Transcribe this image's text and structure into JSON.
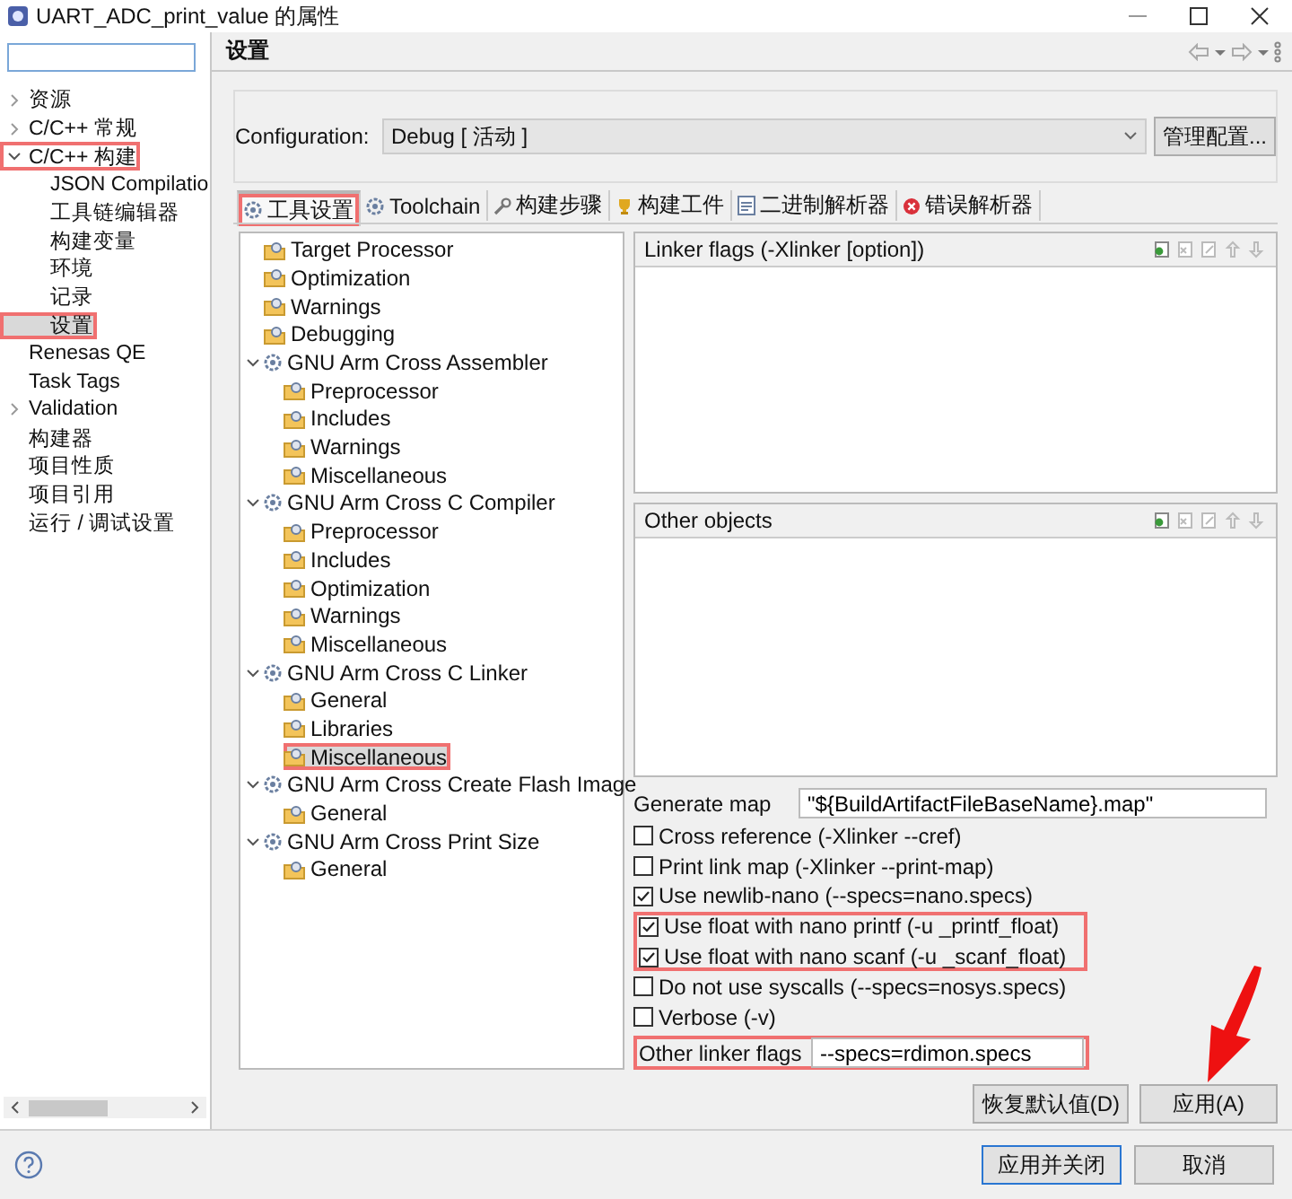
{
  "window": {
    "title": "UART_ADC_print_value 的属性"
  },
  "nav": {
    "items": [
      {
        "label": "资源",
        "expanded": false,
        "selected": false,
        "highlighted": false
      },
      {
        "label": "C/C++ 常规",
        "expanded": false,
        "selected": false,
        "highlighted": false
      },
      {
        "label": "C/C++ 构建",
        "expanded": true,
        "selected": false,
        "highlighted": true,
        "children": [
          {
            "label": "JSON Compilatio",
            "selected": false,
            "highlighted": false
          },
          {
            "label": "工具链编辑器",
            "selected": false,
            "highlighted": false
          },
          {
            "label": "构建变量",
            "selected": false,
            "highlighted": false
          },
          {
            "label": "环境",
            "selected": false,
            "highlighted": false
          },
          {
            "label": "记录",
            "selected": false,
            "highlighted": false
          },
          {
            "label": "设置",
            "selected": true,
            "highlighted": true
          }
        ]
      },
      {
        "label": "Renesas QE",
        "selected": false,
        "highlighted": false
      },
      {
        "label": "Task Tags",
        "selected": false,
        "highlighted": false
      },
      {
        "label": "Validation",
        "expanded": false,
        "selected": false,
        "highlighted": false
      },
      {
        "label": "构建器",
        "selected": false,
        "highlighted": false
      },
      {
        "label": "项目性质",
        "selected": false,
        "highlighted": false
      },
      {
        "label": "项目引用",
        "selected": false,
        "highlighted": false
      },
      {
        "label": "运行 / 调试设置",
        "selected": false,
        "highlighted": false
      }
    ]
  },
  "page": {
    "title": "设置"
  },
  "configuration": {
    "label": "Configuration:",
    "value": "Debug  [ 活动 ]",
    "button": "管理配置..."
  },
  "tabs": [
    {
      "label": "工具设置",
      "selected": true,
      "highlighted": true
    },
    {
      "label": "Toolchain",
      "selected": false,
      "highlighted": false
    },
    {
      "label": "构建步骤",
      "selected": false,
      "highlighted": false
    },
    {
      "label": "构建工件",
      "selected": false,
      "highlighted": false
    },
    {
      "label": "二进制解析器",
      "selected": false,
      "highlighted": false
    },
    {
      "label": "错误解析器",
      "selected": false,
      "highlighted": false
    }
  ],
  "tool_tree": [
    {
      "kind": "option",
      "label": "Target Processor",
      "selected": false,
      "highlighted": false
    },
    {
      "kind": "option",
      "label": "Optimization",
      "selected": false,
      "highlighted": false
    },
    {
      "kind": "option",
      "label": "Warnings",
      "selected": false,
      "highlighted": false
    },
    {
      "kind": "option",
      "label": "Debugging",
      "selected": false,
      "highlighted": false
    },
    {
      "kind": "category",
      "label": "GNU Arm Cross Assembler",
      "expanded": true,
      "selected": false,
      "highlighted": false,
      "children": [
        {
          "kind": "option",
          "label": "Preprocessor",
          "selected": false,
          "highlighted": false
        },
        {
          "kind": "option",
          "label": "Includes",
          "selected": false,
          "highlighted": false
        },
        {
          "kind": "option",
          "label": "Warnings",
          "selected": false,
          "highlighted": false
        },
        {
          "kind": "option",
          "label": "Miscellaneous",
          "selected": false,
          "highlighted": false
        }
      ]
    },
    {
      "kind": "category",
      "label": "GNU Arm Cross C Compiler",
      "expanded": true,
      "selected": false,
      "highlighted": false,
      "children": [
        {
          "kind": "option",
          "label": "Preprocessor",
          "selected": false,
          "highlighted": false
        },
        {
          "kind": "option",
          "label": "Includes",
          "selected": false,
          "highlighted": false
        },
        {
          "kind": "option",
          "label": "Optimization",
          "selected": false,
          "highlighted": false
        },
        {
          "kind": "option",
          "label": "Warnings",
          "selected": false,
          "highlighted": false
        },
        {
          "kind": "option",
          "label": "Miscellaneous",
          "selected": false,
          "highlighted": false
        }
      ]
    },
    {
      "kind": "category",
      "label": "GNU Arm Cross C Linker",
      "expanded": true,
      "selected": false,
      "highlighted": false,
      "children": [
        {
          "kind": "option",
          "label": "General",
          "selected": false,
          "highlighted": false
        },
        {
          "kind": "option",
          "label": "Libraries",
          "selected": false,
          "highlighted": false
        },
        {
          "kind": "option",
          "label": "Miscellaneous",
          "selected": true,
          "highlighted": true
        }
      ]
    },
    {
      "kind": "category",
      "label": "GNU Arm Cross Create Flash Image",
      "expanded": true,
      "selected": false,
      "highlighted": false,
      "children": [
        {
          "kind": "option",
          "label": "General",
          "selected": false,
          "highlighted": false
        }
      ]
    },
    {
      "kind": "category",
      "label": "GNU Arm Cross Print Size",
      "expanded": true,
      "selected": false,
      "highlighted": false,
      "children": [
        {
          "kind": "option",
          "label": "General",
          "selected": false,
          "highlighted": false
        }
      ]
    }
  ],
  "lists": [
    {
      "title": "Linker flags (-Xlinker [option])"
    },
    {
      "title": "Other objects"
    }
  ],
  "generate_map": {
    "label": "Generate map",
    "value": "\"${BuildArtifactFileBaseName}.map\""
  },
  "checkboxes": [
    {
      "label": "Cross reference (-Xlinker --cref)",
      "checked": false,
      "highlighted": false
    },
    {
      "label": "Print link map (-Xlinker --print-map)",
      "checked": false,
      "highlighted": false
    },
    {
      "label": "Use newlib-nano (--specs=nano.specs)",
      "checked": true,
      "highlighted": false
    },
    {
      "label": "Use float with nano printf (-u _printf_float)",
      "checked": true,
      "highlighted": true
    },
    {
      "label": "Use float with nano scanf (-u _scanf_float)",
      "checked": true,
      "highlighted": true
    },
    {
      "label": "Do not use syscalls (--specs=nosys.specs)",
      "checked": false,
      "highlighted": false
    },
    {
      "label": "Verbose (-v)",
      "checked": false,
      "highlighted": false
    }
  ],
  "other_linker_flags": {
    "label": "Other linker flags",
    "value": "--specs=rdimon.specs",
    "highlighted": true
  },
  "page_buttons": [
    "恢复默认值(D)",
    "应用(A)"
  ],
  "footer_buttons": [
    "应用并关闭",
    "取消"
  ]
}
